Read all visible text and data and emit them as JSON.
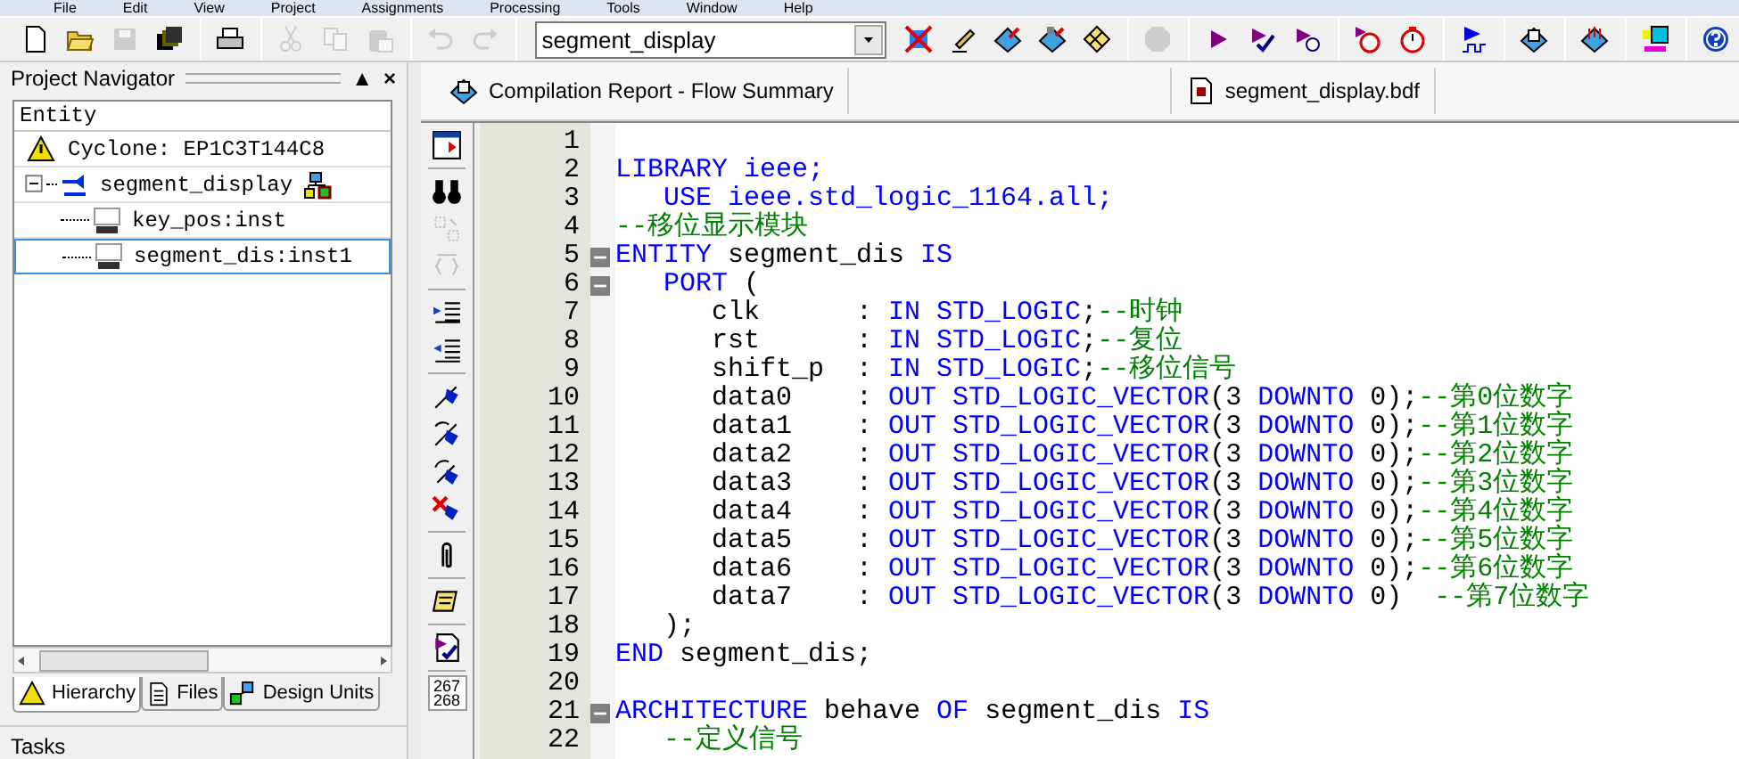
{
  "menu": [
    "File",
    "Edit",
    "View",
    "Project",
    "Assignments",
    "Processing",
    "Tools",
    "Window",
    "Help"
  ],
  "toolbar": {
    "left_buttons": [
      {
        "disabled": false
      },
      {
        "disabled": false
      },
      {
        "disabled": true
      },
      {
        "disabled": false
      },
      {
        "disabled": false
      },
      {
        "disabled": true
      },
      {
        "disabled": true
      },
      {
        "disabled": true
      },
      {
        "disabled": true
      },
      {
        "disabled": true
      }
    ],
    "dropdown": {
      "value": "segment_display"
    },
    "right_buttons": [
      {
        "disabled": false
      },
      {
        "disabled": false
      },
      {
        "disabled": false
      },
      {
        "disabled": false
      },
      {
        "disabled": false
      },
      {
        "disabled": true
      },
      {
        "disabled": false
      },
      {
        "disabled": false
      },
      {
        "disabled": false
      },
      {
        "disabled": false
      },
      {
        "disabled": false
      },
      {
        "disabled": false
      },
      {
        "disabled": false
      },
      {
        "disabled": false
      },
      {
        "disabled": false
      },
      {
        "disabled": false
      }
    ]
  },
  "navigator": {
    "title": "Project Navigator",
    "pin": "▲",
    "close": "×",
    "column": "Entity",
    "tree": [
      {
        "kind": "device",
        "label": "Cyclone: EP1C3T144C8",
        "selected": false
      },
      {
        "kind": "bdf",
        "label": "segment_display",
        "selected": false,
        "expanded": true,
        "children": [
          {
            "kind": "vhd",
            "label": "key_pos:inst",
            "selected": false
          },
          {
            "kind": "vhd",
            "label": "segment_dis:inst1",
            "selected": true
          }
        ]
      }
    ],
    "tabs": [
      {
        "label": "Hierarchy",
        "selected": true
      },
      {
        "label": "Files",
        "selected": false
      },
      {
        "label": "Design Units",
        "selected": false
      }
    ],
    "next_panel": "Tasks"
  },
  "documents": [
    {
      "label": "Compilation Report - Flow Summary"
    },
    {
      "label": "segment_display.bdf"
    }
  ],
  "side_toolbar": {
    "buttons": [
      {
        "disabled": false
      },
      {
        "disabled": false
      },
      {
        "disabled": true
      },
      {
        "disabled": true
      },
      {
        "disabled": false
      },
      {
        "disabled": false
      },
      {
        "disabled": false
      },
      {
        "disabled": false
      },
      {
        "disabled": false
      },
      {
        "disabled": false
      },
      {
        "disabled": false
      },
      {
        "disabled": false
      },
      {
        "disabled": false
      }
    ],
    "goto_line": [
      "267",
      "268"
    ]
  },
  "code": [
    {
      "number": "1",
      "fold": false
    },
    {
      "number": "2",
      "fold": false,
      "tokens": [
        {
          "kind": "keyword",
          "text": "LIBRARY ieee;"
        }
      ]
    },
    {
      "number": "3",
      "fold": false,
      "tokens": [
        {
          "kind": "keyword",
          "text": "   USE ieee.std_logic_1164.all;"
        }
      ]
    },
    {
      "number": "4",
      "fold": false,
      "tokens": [
        {
          "kind": "comment",
          "text": "--移位显示模块"
        }
      ]
    },
    {
      "number": "5",
      "fold": true,
      "tokens": [
        {
          "kind": "keyword",
          "text": "ENTITY"
        },
        {
          "kind": "plain",
          "text": " segment_dis "
        },
        {
          "kind": "keyword",
          "text": "IS"
        }
      ]
    },
    {
      "number": "6",
      "fold": true,
      "tokens": [
        {
          "kind": "keyword",
          "text": "   PORT"
        },
        {
          "kind": "plain",
          "text": " ("
        }
      ]
    },
    {
      "number": "7",
      "fold": false,
      "tokens": [
        {
          "kind": "plain",
          "text": "      clk      : "
        },
        {
          "kind": "keyword",
          "text": "IN STD_LOGIC"
        },
        {
          "kind": "plain",
          "text": ";"
        },
        {
          "kind": "comment",
          "text": "--时钟"
        }
      ]
    },
    {
      "number": "8",
      "fold": false,
      "tokens": [
        {
          "kind": "plain",
          "text": "      rst      : "
        },
        {
          "kind": "keyword",
          "text": "IN STD_LOGIC"
        },
        {
          "kind": "plain",
          "text": ";"
        },
        {
          "kind": "comment",
          "text": "--复位"
        }
      ]
    },
    {
      "number": "9",
      "fold": false,
      "tokens": [
        {
          "kind": "plain",
          "text": "      shift_p  : "
        },
        {
          "kind": "keyword",
          "text": "IN STD_LOGIC"
        },
        {
          "kind": "plain",
          "text": ";"
        },
        {
          "kind": "comment",
          "text": "--移位信号"
        }
      ]
    },
    {
      "number": "10",
      "fold": false,
      "tokens": [
        {
          "kind": "plain",
          "text": "      data0    : "
        },
        {
          "kind": "keyword",
          "text": "OUT STD_LOGIC_VECTOR"
        },
        {
          "kind": "plain",
          "text": "(3 "
        },
        {
          "kind": "keyword",
          "text": "DOWNTO"
        },
        {
          "kind": "plain",
          "text": " 0);"
        },
        {
          "kind": "comment",
          "text": "--第0位数字"
        }
      ]
    },
    {
      "number": "11",
      "fold": false,
      "tokens": [
        {
          "kind": "plain",
          "text": "      data1    : "
        },
        {
          "kind": "keyword",
          "text": "OUT STD_LOGIC_VECTOR"
        },
        {
          "kind": "plain",
          "text": "(3 "
        },
        {
          "kind": "keyword",
          "text": "DOWNTO"
        },
        {
          "kind": "plain",
          "text": " 0);"
        },
        {
          "kind": "comment",
          "text": "--第1位数字"
        }
      ]
    },
    {
      "number": "12",
      "fold": false,
      "tokens": [
        {
          "kind": "plain",
          "text": "      data2    : "
        },
        {
          "kind": "keyword",
          "text": "OUT STD_LOGIC_VECTOR"
        },
        {
          "kind": "plain",
          "text": "(3 "
        },
        {
          "kind": "keyword",
          "text": "DOWNTO"
        },
        {
          "kind": "plain",
          "text": " 0);"
        },
        {
          "kind": "comment",
          "text": "--第2位数字"
        }
      ]
    },
    {
      "number": "13",
      "fold": false,
      "tokens": [
        {
          "kind": "plain",
          "text": "      data3    : "
        },
        {
          "kind": "keyword",
          "text": "OUT STD_LOGIC_VECTOR"
        },
        {
          "kind": "plain",
          "text": "(3 "
        },
        {
          "kind": "keyword",
          "text": "DOWNTO"
        },
        {
          "kind": "plain",
          "text": " 0);"
        },
        {
          "kind": "comment",
          "text": "--第3位数字"
        }
      ]
    },
    {
      "number": "14",
      "fold": false,
      "tokens": [
        {
          "kind": "plain",
          "text": "      data4    : "
        },
        {
          "kind": "keyword",
          "text": "OUT STD_LOGIC_VECTOR"
        },
        {
          "kind": "plain",
          "text": "(3 "
        },
        {
          "kind": "keyword",
          "text": "DOWNTO"
        },
        {
          "kind": "plain",
          "text": " 0);"
        },
        {
          "kind": "comment",
          "text": "--第4位数字"
        }
      ]
    },
    {
      "number": "15",
      "fold": false,
      "tokens": [
        {
          "kind": "plain",
          "text": "      data5    : "
        },
        {
          "kind": "keyword",
          "text": "OUT STD_LOGIC_VECTOR"
        },
        {
          "kind": "plain",
          "text": "(3 "
        },
        {
          "kind": "keyword",
          "text": "DOWNTO"
        },
        {
          "kind": "plain",
          "text": " 0);"
        },
        {
          "kind": "comment",
          "text": "--第5位数字"
        }
      ]
    },
    {
      "number": "16",
      "fold": false,
      "tokens": [
        {
          "kind": "plain",
          "text": "      data6    : "
        },
        {
          "kind": "keyword",
          "text": "OUT STD_LOGIC_VECTOR"
        },
        {
          "kind": "plain",
          "text": "(3 "
        },
        {
          "kind": "keyword",
          "text": "DOWNTO"
        },
        {
          "kind": "plain",
          "text": " 0);"
        },
        {
          "kind": "comment",
          "text": "--第6位数字"
        }
      ]
    },
    {
      "number": "17",
      "fold": false,
      "tokens": [
        {
          "kind": "plain",
          "text": "      data7    : "
        },
        {
          "kind": "keyword",
          "text": "OUT STD_LOGIC_VECTOR"
        },
        {
          "kind": "plain",
          "text": "(3 "
        },
        {
          "kind": "keyword",
          "text": "DOWNTO"
        },
        {
          "kind": "plain",
          "text": " 0)  "
        },
        {
          "kind": "comment",
          "text": "--第7位数字"
        }
      ]
    },
    {
      "number": "18",
      "fold": false,
      "tokens": [
        {
          "kind": "plain",
          "text": "   );"
        }
      ]
    },
    {
      "number": "19",
      "fold": false,
      "tokens": [
        {
          "kind": "keyword",
          "text": "END"
        },
        {
          "kind": "plain",
          "text": " segment_dis;"
        }
      ]
    },
    {
      "number": "20",
      "fold": false
    },
    {
      "number": "21",
      "fold": true,
      "tokens": [
        {
          "kind": "keyword",
          "text": "ARCHITECTURE"
        },
        {
          "kind": "plain",
          "text": " behave "
        },
        {
          "kind": "keyword",
          "text": "OF"
        },
        {
          "kind": "plain",
          "text": " segment_dis "
        },
        {
          "kind": "keyword",
          "text": "IS"
        }
      ]
    },
    {
      "number": "22",
      "fold": false,
      "tokens": [
        {
          "kind": "comment",
          "text": "   --定义信号"
        }
      ]
    }
  ]
}
